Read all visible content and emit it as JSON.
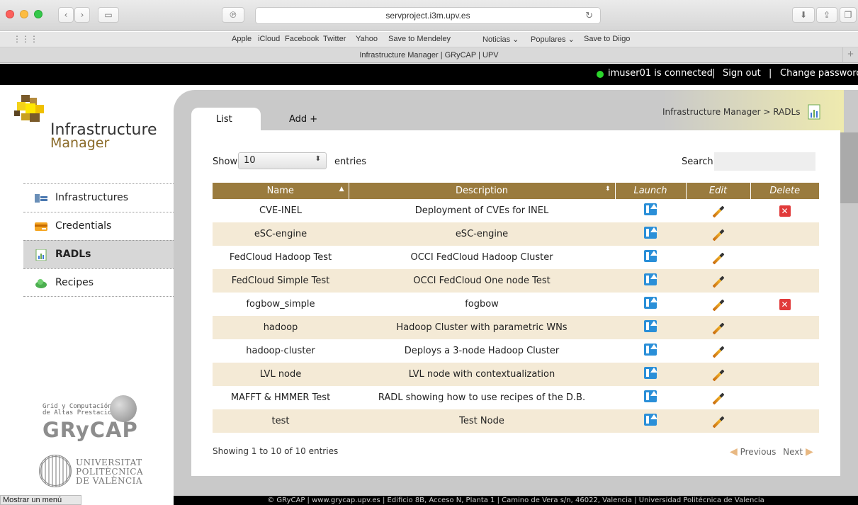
{
  "browser": {
    "url": "servproject.i3m.upv.es",
    "tab_title": "Infrastructure Manager | GRyCAP | UPV",
    "bookmarks": [
      "Apple",
      "iCloud",
      "Facebook",
      "Twitter",
      "Yahoo",
      "Save to Mendeley",
      "Noticias ⌄",
      "Populares ⌄",
      "Save to Diigo"
    ],
    "status_text": "Mostrar un menú"
  },
  "userbar": {
    "status": "imuser01 is connected",
    "sign_out": "Sign out",
    "change_password": "Change password",
    "separator": "|"
  },
  "sidebar": {
    "logo_title": "Infrastructure",
    "logo_sub": "Manager",
    "items": [
      {
        "label": "Infrastructures",
        "icon": "server-icon"
      },
      {
        "label": "Credentials",
        "icon": "credential-card-icon"
      },
      {
        "label": "RADLs",
        "icon": "radl-document-icon"
      },
      {
        "label": "Recipes",
        "icon": "recipe-cloud-icon"
      }
    ],
    "grycap_small": "Grid y Computación\nde Altas Prestaciones",
    "grycap_logo": "GRyCAP",
    "upv_text": "UNIVERSITAT\nPOLITÈCNICA\nDE VALÈNCIA"
  },
  "main": {
    "breadcrumb": "Infrastructure Manager > RADLs",
    "tabs": [
      {
        "label": "List"
      },
      {
        "label": "Add +"
      }
    ],
    "show_label": "Show",
    "page_size": "10",
    "entries_label": "entries",
    "search_label": "Search:",
    "search_value": "",
    "columns": [
      "Name",
      "Description",
      "Launch",
      "Edit",
      "Delete"
    ],
    "rows": [
      {
        "name": "CVE-INEL",
        "description": "Deployment of CVEs for INEL",
        "deletable": true
      },
      {
        "name": "eSC-engine",
        "description": "eSC-engine",
        "deletable": false
      },
      {
        "name": "FedCloud Hadoop Test",
        "description": "OCCI FedCloud Hadoop Cluster",
        "deletable": false
      },
      {
        "name": "FedCloud Simple Test",
        "description": "OCCI FedCloud One node Test",
        "deletable": false
      },
      {
        "name": "fogbow_simple",
        "description": "fogbow",
        "deletable": true
      },
      {
        "name": "hadoop",
        "description": "Hadoop Cluster with parametric WNs",
        "deletable": false
      },
      {
        "name": "hadoop-cluster",
        "description": "Deploys a 3-node Hadoop Cluster",
        "deletable": false
      },
      {
        "name": "LVL node",
        "description": "LVL node with contextualization",
        "deletable": false
      },
      {
        "name": "MAFFT & HMMER Test",
        "description": "RADL showing how to use recipes of the D.B.",
        "deletable": false
      },
      {
        "name": "test",
        "description": "Test Node",
        "deletable": false
      }
    ],
    "showing": "Showing 1 to 10 of 10 entries",
    "previous": "Previous",
    "next": "Next"
  },
  "footer": "© GRyCAP  |  www.grycap.upv.es  |  Edificio 8B, Acceso N, Planta 1  |  Camino de Vera s/n, 46022, Valencia  |  Universidad Politécnica de Valencia",
  "colors": {
    "header": "#9a7b3e",
    "row_alt": "#f4ead6",
    "status": "#2bd52b"
  }
}
